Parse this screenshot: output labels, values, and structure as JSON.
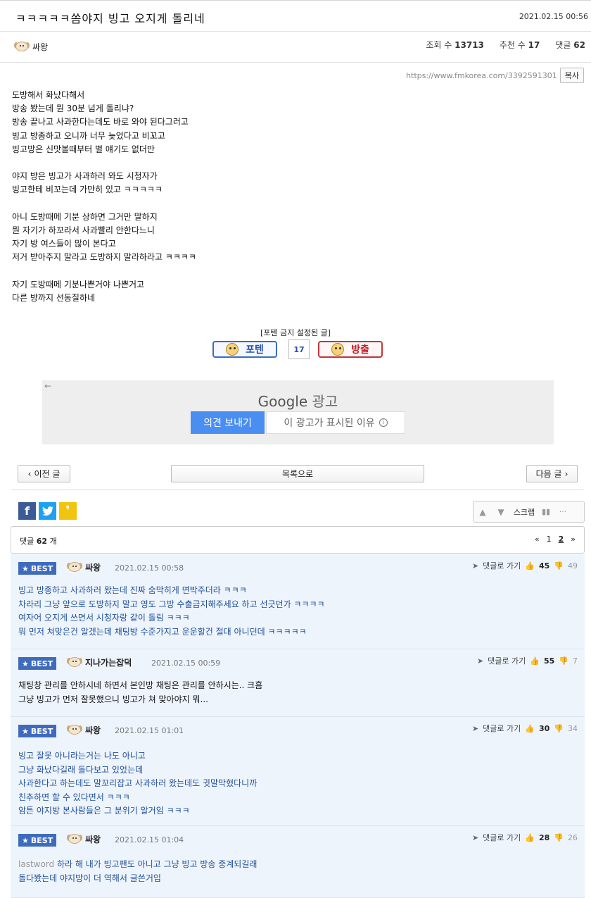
{
  "post": {
    "title": "ㅋㅋㅋㅋㅋ쏨야지 빙고 오지게 돌리네",
    "date": "2021.02.15 00:56",
    "author": "싸왕",
    "views_label": "조회 수",
    "views": "13713",
    "likes_label": "추천 수",
    "likes": "17",
    "comments_label": "댓글",
    "comments": "62",
    "url": "https://www.fmkorea.com/3392591301",
    "copy_label": "복사",
    "body": [
      "도방해서 화났다해서",
      "방송 봤는데 뭔 30분 넘게 돌리냐?",
      "방송 끝나고 사과한다는데도 바로 와야 된다그러고",
      "빙고 방종하고 오니까 너무 늦었다고 비꼬고",
      "빙고방은 신맛볼때부터 별 얘기도 없더만",
      "",
      "야지 방은 빙고가 사과하러 와도 시청자가",
      "빙고한테 비꼬는데 가만히 있고 ㅋㅋㅋㅋㅋ",
      "",
      "아니 도방때메 기분 상하면 그거만 말하지",
      "뭔 자기가 하꼬라서 사과빨리 안한다느니",
      "자기 방 여스들이 많이 본다고",
      "저거 받아주지 말라고 도방하지 말라하라고 ㅋㅋㅋㅋ",
      "",
      "자기 도방때메 기분나쁜거야 나쁜거고",
      "다른 방까지 선동질하네"
    ]
  },
  "vote": {
    "notice": "[포텐 금지 설정된 글]",
    "poten_label": "포텐",
    "count": "17",
    "bangchul_label": "방출"
  },
  "ad": {
    "back": "←",
    "brand": "Google",
    "label": "광고",
    "feedback": "의견 보내기",
    "why": "이 광고가 표시된 이유"
  },
  "nav": {
    "prev": "이전 글",
    "list": "목록으로",
    "next": "다음 글"
  },
  "tools": {
    "scrap": "스크랩"
  },
  "comments_header": {
    "label": "댓글",
    "count": "62",
    "unit": "개",
    "pages": [
      "«",
      "1",
      "2",
      "»"
    ]
  },
  "comments": [
    {
      "badge": "BEST",
      "author": "싸왕",
      "date": "2021.02.15 00:58",
      "reply": "댓글로 가기",
      "up": "45",
      "down": "49",
      "lines": [
        "빙고 방종하고 사과하러 왔는데 진짜 숨막히게 면박주더라 ㅋㅋㅋ",
        "차라리 그냥 앞으로 도방하지 말고 영도 그방 수출금지해주세요 하고 선긋던가 ㅋㅋㅋㅋ",
        "여자어 오지게 쓰면서 시청자랑 같이 돌림 ㅋㅋㅋ",
        "뭐 먼저 쳐맞은건 알겠는데 채팅방 수준가지고 운운할건 절대 아니던데 ㅋㅋㅋㅋㅋ"
      ]
    },
    {
      "badge": "BEST",
      "author": "지나가는잡덕",
      "date": "2021.02.15 00:59",
      "reply": "댓글로 가기",
      "up": "55",
      "down": "7",
      "lines": [
        "채팅창 관리를 안하시네 하면서 본인방 채팅은 관리를 안하시는.. 크흠",
        "그냥 빙고가 먼저 잘못했으니 빙고가 쳐 맞아야지 뭐..."
      ]
    },
    {
      "badge": "BEST",
      "author": "싸왕",
      "date": "2021.02.15 01:01",
      "reply": "댓글로 가기",
      "up": "30",
      "down": "34",
      "lines": [
        "빙고 잘못 아니라는거는 나도 아니고",
        "그냥 화났다길래 돌다보고 있었는데",
        "사과한다고 하는데도 말꼬리잡고 사과하러 왔는데도 귓말막혔다니까",
        "친추하면 할 수 있다면서 ㅋㅋㅋ",
        "암튼 야지방 본사람들은 그 분위기 알거임 ㅋㅋㅋ"
      ]
    },
    {
      "badge": "BEST",
      "author": "싸왕",
      "date": "2021.02.15 01:04",
      "reply": "댓글로 가기",
      "up": "28",
      "down": "26",
      "prefix": "lastword",
      "lines": [
        "하라 해 내가 빙고팬도 아니고 그냥 빙고 방송 중계되길래",
        "돌다봤는데 야지방이 더 역해서 글쓴거임"
      ]
    }
  ]
}
